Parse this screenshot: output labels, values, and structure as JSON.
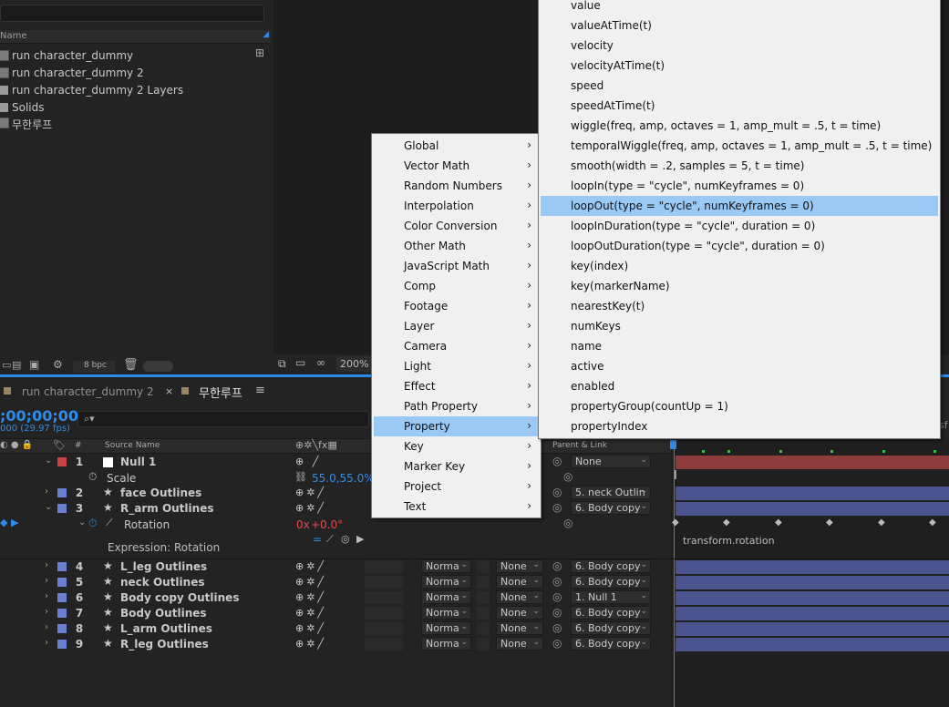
{
  "project": {
    "column_header": "Name",
    "items": [
      {
        "label": "run character_dummy",
        "icon": "comp-icon"
      },
      {
        "label": "run character_dummy 2",
        "icon": "comp-icon"
      },
      {
        "label": "run character_dummy 2 Layers",
        "icon": "folder-icon"
      },
      {
        "label": "Solids",
        "icon": "folder-icon"
      },
      {
        "label": "무한루프",
        "icon": "comp-icon"
      }
    ],
    "bpc": "8 bpc"
  },
  "viewer": {
    "zoom": "200%"
  },
  "timeline": {
    "tabs": [
      {
        "label": "run character_dummy 2"
      },
      {
        "label": "무한루프"
      }
    ],
    "timecode": ";00;00;00",
    "fps": "000 (29.97 fps)",
    "search_icon": "search-icon",
    "columns": {
      "hash": "#",
      "source_name": "Source Name",
      "parent_link": "Parent & Link"
    },
    "layers": [
      {
        "index": "1",
        "name": "Null 1",
        "parent": "None",
        "color": "#c84343"
      },
      {
        "index": "2",
        "name": "face Outlines",
        "parent": "5. neck Outlin",
        "color": "#6a7fd1"
      },
      {
        "index": "3",
        "name": "R_arm Outlines",
        "parent": "6. Body copy",
        "color": "#6a7fd1"
      },
      {
        "index": "4",
        "name": "L_leg Outlines",
        "mode": "Norma",
        "track": "None",
        "parent": "6. Body copy",
        "color": "#6a7fd1"
      },
      {
        "index": "5",
        "name": "neck Outlines",
        "mode": "Norma",
        "track": "None",
        "parent": "6. Body copy",
        "color": "#6a7fd1"
      },
      {
        "index": "6",
        "name": "Body copy Outlines",
        "mode": "Norma",
        "track": "None",
        "parent": "1. Null 1",
        "color": "#6a7fd1"
      },
      {
        "index": "7",
        "name": "Body Outlines",
        "mode": "Norma",
        "track": "None",
        "parent": "6. Body copy",
        "color": "#6a7fd1"
      },
      {
        "index": "8",
        "name": "L_arm Outlines",
        "mode": "Norma",
        "track": "None",
        "parent": "6. Body copy",
        "color": "#6a7fd1"
      },
      {
        "index": "9",
        "name": "R_leg Outlines",
        "mode": "Norma",
        "track": "None",
        "parent": "6. Body copy",
        "color": "#6a7fd1"
      }
    ],
    "scale": {
      "label": "Scale",
      "value": "55.0,55.0%"
    },
    "rotation": {
      "label": "Rotation",
      "value_x": "0x",
      "value_deg": "+0.0°"
    },
    "expression": {
      "label": "Expression: Rotation",
      "code": "transform.rotation"
    },
    "edge_text": "sf"
  },
  "menu1": {
    "items": [
      "Global",
      "Vector Math",
      "Random Numbers",
      "Interpolation",
      "Color Conversion",
      "Other Math",
      "JavaScript Math",
      "Comp",
      "Footage",
      "Layer",
      "Camera",
      "Light",
      "Effect",
      "Path Property",
      "Property",
      "Key",
      "Marker Key",
      "Project",
      "Text"
    ],
    "selected": "Property"
  },
  "menu2": {
    "items": [
      "value",
      "valueAtTime(t)",
      "velocity",
      "velocityAtTime(t)",
      "speed",
      "speedAtTime(t)",
      "wiggle(freq, amp, octaves = 1, amp_mult = .5, t = time)",
      "temporalWiggle(freq, amp, octaves = 1, amp_mult = .5, t = time)",
      "smooth(width = .2, samples = 5, t = time)",
      "loopIn(type = \"cycle\", numKeyframes = 0)",
      "loopOut(type = \"cycle\", numKeyframes = 0)",
      "loopInDuration(type = \"cycle\", duration = 0)",
      "loopOutDuration(type = \"cycle\", duration = 0)",
      "key(index)",
      "key(markerName)",
      "nearestKey(t)",
      "numKeys",
      "name",
      "active",
      "enabled",
      "propertyGroup(countUp = 1)",
      "propertyIndex"
    ],
    "selected": "loopOut(type = \"cycle\", numKeyframes = 0)"
  },
  "colors": {
    "accent": "#2d8ceb",
    "menu_highlight": "#99c9f4",
    "layer_bar": "#4a538e",
    "null_bar": "#8e3b3b"
  }
}
